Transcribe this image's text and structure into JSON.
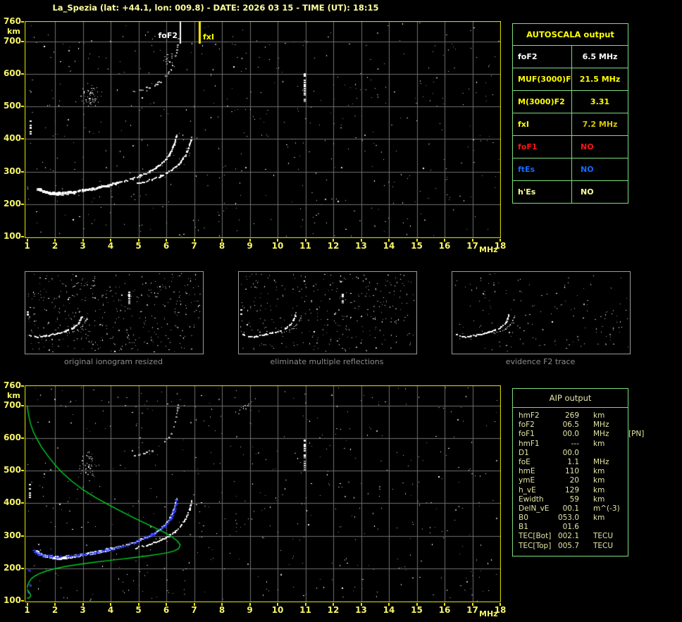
{
  "title": "La_Spezia (lat: +44.1, lon: 009.8) - DATE: 2026 03 15 - TIME (UT): 18:15",
  "colors": {
    "background": "#000000",
    "title_text": "#ffffa0",
    "axis_text": "#f6f468",
    "plot_border": "#eaea00",
    "grid": "#6f6f6f",
    "table_border": "#7edc7e",
    "autoscala_yellow": "#ffff00",
    "white": "#ffffff",
    "gold": "#d8c800",
    "red": "#ff1414",
    "blue": "#1569ff",
    "pale_yellow": "#ffff9a",
    "aip_text": "#e4e4a6",
    "caption_text": "#8c8c8c",
    "thumb_border": "#9a9a9a",
    "profile_green": "#00d020",
    "restored_blue": "#2e41f0"
  },
  "autoscala": {
    "title": "AUTOSCALA output",
    "rows": [
      {
        "label": "foF2",
        "value": "6.5 MHz",
        "label_color": "white",
        "value_color": "white",
        "align": "center"
      },
      {
        "label": "MUF(3000)F2",
        "value": "21.5 MHz",
        "label_color": "autoscala_yellow",
        "value_color": "autoscala_yellow",
        "align": "center"
      },
      {
        "label": "M(3000)F2",
        "value": "3.31",
        "label_color": "autoscala_yellow",
        "value_color": "autoscala_yellow",
        "align": "center"
      },
      {
        "label": "fxI",
        "value": "7.2 MHz",
        "label_color": "autoscala_yellow",
        "value_color": "gold",
        "align": "center"
      },
      {
        "label": "foF1",
        "value": "NO",
        "label_color": "red",
        "value_color": "red",
        "align": "left"
      },
      {
        "label": "ftEs",
        "value": "NO",
        "label_color": "blue",
        "value_color": "blue",
        "align": "left"
      },
      {
        "label": "h'Es",
        "value": "NO",
        "label_color": "pale_yellow",
        "value_color": "pale_yellow",
        "align": "left"
      }
    ]
  },
  "aip": {
    "title": "AIP output",
    "rows": [
      {
        "label": "hmF2",
        "value": "269",
        "unit": "km",
        "extra": ""
      },
      {
        "label": "foF2",
        "value": "06.5",
        "unit": "MHz",
        "extra": ""
      },
      {
        "label": "foF1",
        "value": "00.0",
        "unit": "MHz",
        "extra": "[PN]"
      },
      {
        "label": "hmF1",
        "value": "---",
        "unit": "km",
        "extra": ""
      },
      {
        "label": "D1",
        "value": "00.0",
        "unit": "",
        "extra": ""
      },
      {
        "label": "foE",
        "value": "1.1",
        "unit": "MHz",
        "extra": ""
      },
      {
        "label": "hmE",
        "value": "110",
        "unit": "km",
        "extra": ""
      },
      {
        "label": "ymE",
        "value": "20",
        "unit": "km",
        "extra": ""
      },
      {
        "label": "h_vE",
        "value": "129",
        "unit": "km",
        "extra": ""
      },
      {
        "label": "Ewidth",
        "value": "59",
        "unit": "km",
        "extra": ""
      },
      {
        "label": "DelN_vE",
        "value": "00.1",
        "unit": "m^(-3)",
        "extra": ""
      },
      {
        "label": "B0",
        "value": "053.0",
        "unit": "km",
        "extra": ""
      },
      {
        "label": "B1",
        "value": "01.6",
        "unit": "",
        "extra": ""
      },
      {
        "label": "TEC[Bot]",
        "value": "002.1",
        "unit": "TECU",
        "extra": ""
      },
      {
        "label": "TEC[Top]",
        "value": "005.7",
        "unit": "TECU",
        "extra": ""
      }
    ]
  },
  "thumbnails": [
    {
      "caption": "original ionogram resized"
    },
    {
      "caption": "eliminate multiple reflections"
    },
    {
      "caption": "evidence F2 trace"
    }
  ],
  "chart_data": [
    {
      "id": "ionogram_top",
      "type": "scatter",
      "title": "",
      "xlabel": "MHz",
      "ylabel": "km",
      "xlim": [
        1,
        18
      ],
      "ylim": [
        100,
        760
      ],
      "x_ticks": [
        1,
        2,
        3,
        4,
        5,
        6,
        7,
        8,
        9,
        10,
        11,
        12,
        13,
        14,
        15,
        16,
        17,
        18
      ],
      "y_ticks": [
        760,
        700,
        600,
        500,
        400,
        300,
        200,
        100
      ],
      "grid": true,
      "markers": {
        "foF2_MHz": 6.5,
        "fxI_MHz": 7.2
      },
      "annotations": [
        {
          "text": "foF2",
          "x_MHz": 6.5,
          "color": "white"
        },
        {
          "text": "fxI",
          "x_MHz": 7.2,
          "color": "autoscala_yellow"
        }
      ],
      "series": [
        {
          "name": "F2 trace (o-mode)",
          "style": "trace",
          "color": "white",
          "points": [
            [
              1.35,
              250
            ],
            [
              1.5,
              242
            ],
            [
              1.65,
              237
            ],
            [
              1.85,
              234
            ],
            [
              2.1,
              232
            ],
            [
              2.4,
              233
            ],
            [
              2.7,
              236
            ],
            [
              3.0,
              241
            ],
            [
              3.3,
              246
            ],
            [
              3.6,
              251
            ],
            [
              3.9,
              257
            ],
            [
              4.2,
              263
            ],
            [
              4.5,
              270
            ],
            [
              4.8,
              278
            ],
            [
              5.1,
              288
            ],
            [
              5.4,
              299
            ],
            [
              5.65,
              312
            ],
            [
              5.85,
              325
            ],
            [
              6.0,
              338
            ],
            [
              6.1,
              350
            ],
            [
              6.2,
              365
            ],
            [
              6.28,
              382
            ],
            [
              6.34,
              400
            ],
            [
              6.38,
              412
            ]
          ]
        },
        {
          "name": "F2 trace (x-mode)",
          "style": "trace2",
          "color": "white",
          "points": [
            [
              4.9,
              262
            ],
            [
              5.2,
              268
            ],
            [
              5.5,
              276
            ],
            [
              5.8,
              286
            ],
            [
              6.05,
              297
            ],
            [
              6.3,
              311
            ],
            [
              6.5,
              327
            ],
            [
              6.65,
              345
            ],
            [
              6.77,
              365
            ],
            [
              6.86,
              386
            ],
            [
              6.92,
              405
            ]
          ]
        },
        {
          "name": "second-hop echo",
          "style": "gray-trace",
          "color": "gray",
          "points": [
            [
              4.85,
              545
            ],
            [
              5.2,
              552
            ],
            [
              5.5,
              562
            ],
            [
              5.75,
              574
            ],
            [
              5.95,
              588
            ],
            [
              6.1,
              603
            ],
            [
              6.22,
              620
            ],
            [
              6.3,
              640
            ],
            [
              6.36,
              662
            ],
            [
              6.41,
              688
            ],
            [
              6.44,
              710
            ]
          ]
        },
        {
          "name": "interference streak",
          "style": "vstreak",
          "points": [
            [
              10.95,
              602
            ],
            [
              10.95,
              500
            ]
          ]
        },
        {
          "name": "left edge echo",
          "style": "vstreak-white",
          "points": [
            [
              1.12,
              458
            ],
            [
              1.12,
              412
            ]
          ]
        }
      ]
    },
    {
      "id": "ionogram_bottom",
      "type": "scatter",
      "title": "",
      "xlabel": "MHz",
      "ylabel": "km",
      "xlim": [
        1,
        18
      ],
      "ylim": [
        100,
        760
      ],
      "x_ticks": [
        1,
        2,
        3,
        4,
        5,
        6,
        7,
        8,
        9,
        10,
        11,
        12,
        13,
        14,
        15,
        16,
        17,
        18
      ],
      "y_ticks": [
        760,
        700,
        600,
        500,
        400,
        300,
        200,
        100
      ],
      "grid": true,
      "series": [
        {
          "name": "F2 trace (o-mode)",
          "style": "trace",
          "color": "white",
          "points": [
            [
              1.35,
              250
            ],
            [
              1.5,
              242
            ],
            [
              1.65,
              237
            ],
            [
              1.85,
              234
            ],
            [
              2.1,
              232
            ],
            [
              2.4,
              233
            ],
            [
              2.7,
              236
            ],
            [
              3.0,
              241
            ],
            [
              3.3,
              246
            ],
            [
              3.6,
              251
            ],
            [
              3.9,
              257
            ],
            [
              4.2,
              263
            ],
            [
              4.5,
              270
            ],
            [
              4.8,
              278
            ],
            [
              5.1,
              288
            ],
            [
              5.4,
              299
            ],
            [
              5.65,
              312
            ],
            [
              5.85,
              325
            ],
            [
              6.0,
              338
            ],
            [
              6.1,
              350
            ],
            [
              6.2,
              365
            ],
            [
              6.28,
              382
            ],
            [
              6.34,
              400
            ],
            [
              6.38,
              412
            ]
          ]
        },
        {
          "name": "F2 trace (x-mode)",
          "style": "trace2",
          "color": "white",
          "points": [
            [
              4.9,
              262
            ],
            [
              5.2,
              268
            ],
            [
              5.5,
              276
            ],
            [
              5.8,
              286
            ],
            [
              6.05,
              297
            ],
            [
              6.3,
              311
            ],
            [
              6.5,
              327
            ],
            [
              6.65,
              345
            ],
            [
              6.77,
              365
            ],
            [
              6.86,
              386
            ],
            [
              6.92,
              405
            ]
          ]
        },
        {
          "name": "second-hop echo",
          "style": "gray-trace",
          "color": "gray",
          "points": [
            [
              4.85,
              545
            ],
            [
              5.2,
              552
            ],
            [
              5.5,
              562
            ],
            [
              5.75,
              574
            ],
            [
              5.95,
              588
            ],
            [
              6.1,
              603
            ],
            [
              6.22,
              620
            ],
            [
              6.3,
              640
            ],
            [
              6.36,
              662
            ],
            [
              6.41,
              688
            ],
            [
              6.44,
              710
            ]
          ]
        },
        {
          "name": "interference streak",
          "style": "vstreak",
          "points": [
            [
              10.95,
              602
            ],
            [
              10.95,
              500
            ]
          ]
        },
        {
          "name": "left edge echo",
          "style": "vstreak-white",
          "points": [
            [
              1.1,
              460
            ],
            [
              1.1,
              415
            ]
          ]
        },
        {
          "name": "restored F2 trace (Autoscala)",
          "style": "crosses",
          "color": "restored_blue",
          "points": [
            [
              1.25,
              255
            ],
            [
              1.4,
              245
            ],
            [
              1.6,
              239
            ],
            [
              1.9,
              236
            ],
            [
              2.2,
              235
            ],
            [
              2.5,
              236
            ],
            [
              2.8,
              239
            ],
            [
              3.1,
              243
            ],
            [
              3.4,
              248
            ],
            [
              3.7,
              253
            ],
            [
              4.0,
              259
            ],
            [
              4.3,
              266
            ],
            [
              4.6,
              273
            ],
            [
              4.9,
              282
            ],
            [
              5.2,
              292
            ],
            [
              5.5,
              304
            ],
            [
              5.75,
              317
            ],
            [
              5.95,
              331
            ],
            [
              6.1,
              346
            ],
            [
              6.2,
              360
            ],
            [
              6.28,
              376
            ],
            [
              6.33,
              392
            ],
            [
              6.36,
              408
            ]
          ]
        },
        {
          "name": "isolated restored points",
          "style": "dots-blue",
          "color": "restored_blue",
          "points": [
            [
              1.07,
              196
            ],
            [
              1.1,
              150
            ],
            [
              1.03,
              128
            ]
          ]
        },
        {
          "name": "electron density profile",
          "style": "line",
          "color": "profile_green",
          "segments": [
            [
              [
                1.0,
                700
              ],
              [
                1.05,
                672
              ],
              [
                1.12,
                645
              ],
              [
                1.22,
                620
              ],
              [
                1.35,
                598
              ],
              [
                1.52,
                572
              ],
              [
                1.75,
                545
              ],
              [
                1.98,
                520
              ],
              [
                2.25,
                495
              ],
              [
                2.6,
                468
              ],
              [
                3.0,
                442
              ],
              [
                3.45,
                418
              ],
              [
                3.95,
                394
              ],
              [
                4.45,
                372
              ],
              [
                4.95,
                350
              ],
              [
                5.45,
                330
              ],
              [
                5.9,
                312
              ],
              [
                6.2,
                297
              ],
              [
                6.4,
                284
              ],
              [
                6.5,
                272
              ],
              [
                6.45,
                261
              ],
              [
                6.3,
                254
              ],
              [
                6.05,
                248
              ],
              [
                5.7,
                243
              ],
              [
                5.3,
                238
              ],
              [
                4.85,
                233
              ],
              [
                4.35,
                228
              ],
              [
                3.85,
                223
              ],
              [
                3.35,
                218
              ],
              [
                2.85,
                212
              ],
              [
                2.4,
                206
              ],
              [
                2.0,
                199
              ],
              [
                1.7,
                192
              ],
              [
                1.45,
                184
              ],
              [
                1.27,
                176
              ],
              [
                1.15,
                168
              ],
              [
                1.07,
                158
              ],
              [
                1.02,
                148
              ],
              [
                1.0,
                140
              ]
            ],
            [
              [
                1.0,
                136
              ],
              [
                1.05,
                129
              ],
              [
                1.1,
                122
              ],
              [
                1.13,
                116
              ],
              [
                1.1,
                111
              ],
              [
                1.04,
                108
              ],
              [
                1.0,
                110
              ]
            ]
          ]
        }
      ]
    }
  ]
}
